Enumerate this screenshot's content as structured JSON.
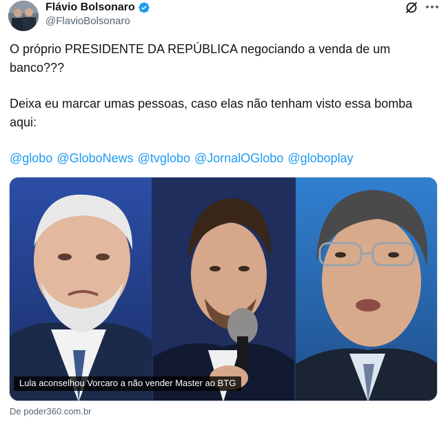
{
  "author": {
    "display_name": "Flávio Bolsonaro",
    "handle": "@FlavioBolsonaro",
    "verified_color": "#1d9bf0"
  },
  "header_actions": {
    "grok_icon": "grok-icon",
    "more_icon": "more-icon"
  },
  "tweet": {
    "paragraph_1": "O próprio PRESIDENTE DA REPÚBLICA negociando a venda de um banco???",
    "paragraph_2": "Deixa eu marcar umas pessoas, caso elas não tenham visto essa bomba aqui:",
    "mentions": [
      "@globo",
      "@GloboNews",
      "@tvglobo",
      "@JornalOGlobo",
      "@globoplay"
    ],
    "mention_color": "#1d9bf0"
  },
  "media": {
    "caption": "Lula aconselhou Vorcaro a não vender Master ao BTG",
    "source": "De poder360.com.br"
  }
}
